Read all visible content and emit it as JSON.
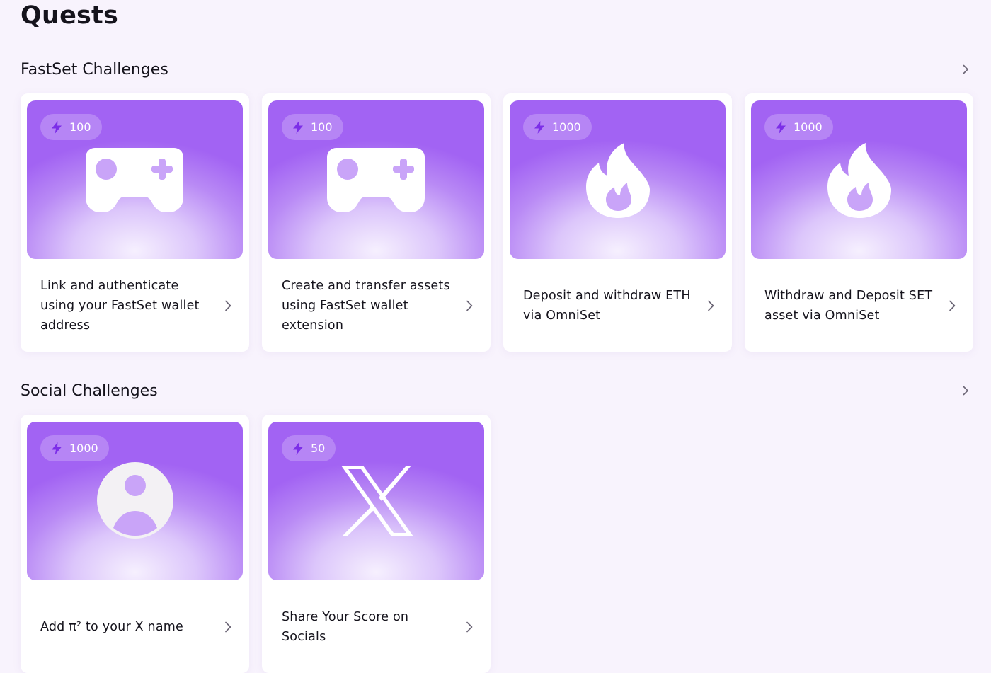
{
  "page": {
    "title": "Quests"
  },
  "sections": [
    {
      "title": "FastSet Challenges",
      "cards": [
        {
          "points": "100",
          "icon": "gamepad-icon",
          "title": "Link and authenticate using your FastSet wallet address"
        },
        {
          "points": "100",
          "icon": "gamepad-icon",
          "title": "Create and transfer assets using FastSet wallet extension"
        },
        {
          "points": "1000",
          "icon": "flame-icon",
          "title": "Deposit and withdraw ETH via OmniSet"
        },
        {
          "points": "1000",
          "icon": "flame-icon",
          "title": "Withdraw and Deposit SET asset via OmniSet"
        }
      ]
    },
    {
      "title": "Social Challenges",
      "cards": [
        {
          "points": "1000",
          "icon": "user-avatar-icon",
          "title": "Add π² to your X name"
        },
        {
          "points": "50",
          "icon": "x-logo-icon",
          "title": "Share Your Score on Socials"
        }
      ]
    }
  ],
  "colors": {
    "background": "#f8f3fd",
    "accent": "#a263f3",
    "bolt": "#7c2ee8",
    "text": "#15131c"
  }
}
